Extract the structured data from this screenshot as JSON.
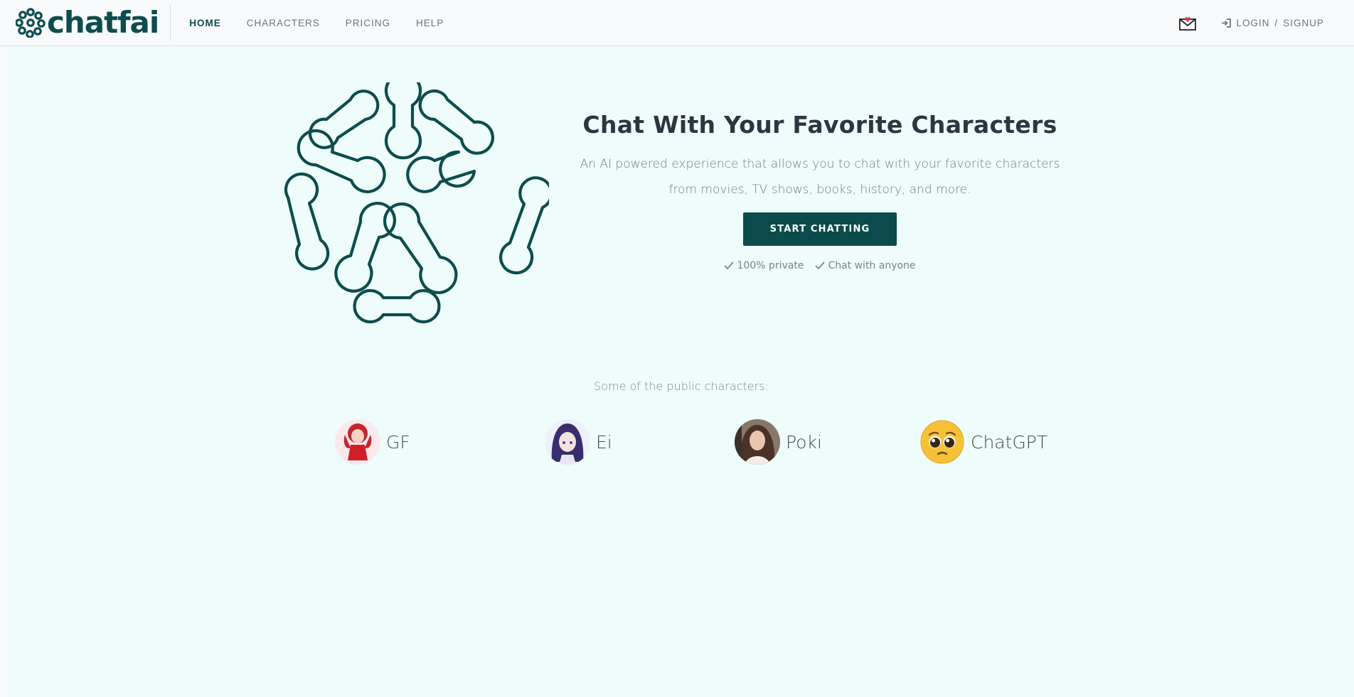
{
  "brand": {
    "name": "chatfai",
    "accent": "#0d4c4d"
  },
  "nav": {
    "items": [
      {
        "label": "HOME",
        "active": true
      },
      {
        "label": "CHARACTERS",
        "active": false
      },
      {
        "label": "PRICING",
        "active": false
      },
      {
        "label": "HELP",
        "active": false
      }
    ],
    "mail_icon": "envelope-heart-icon",
    "login_icon": "sign-in-icon",
    "login_label": "LOGIN",
    "separator": "/",
    "signup_label": "SIGNUP"
  },
  "hero": {
    "title": "Chat With Your Favorite Characters",
    "description": "An AI powered experience that allows you to chat with your favorite characters from movies, TV shows, books, history, and more.",
    "cta_label": "START CHATTING",
    "cta_color": "#0c4b4c",
    "features": [
      "100% private",
      "Chat with anyone"
    ],
    "feature_icon": "check-icon"
  },
  "public_characters": {
    "label": "Some of the public characters:",
    "items": [
      {
        "name": "GF"
      },
      {
        "name": "Ei"
      },
      {
        "name": "Poki"
      },
      {
        "name": "ChatGPT"
      }
    ]
  }
}
